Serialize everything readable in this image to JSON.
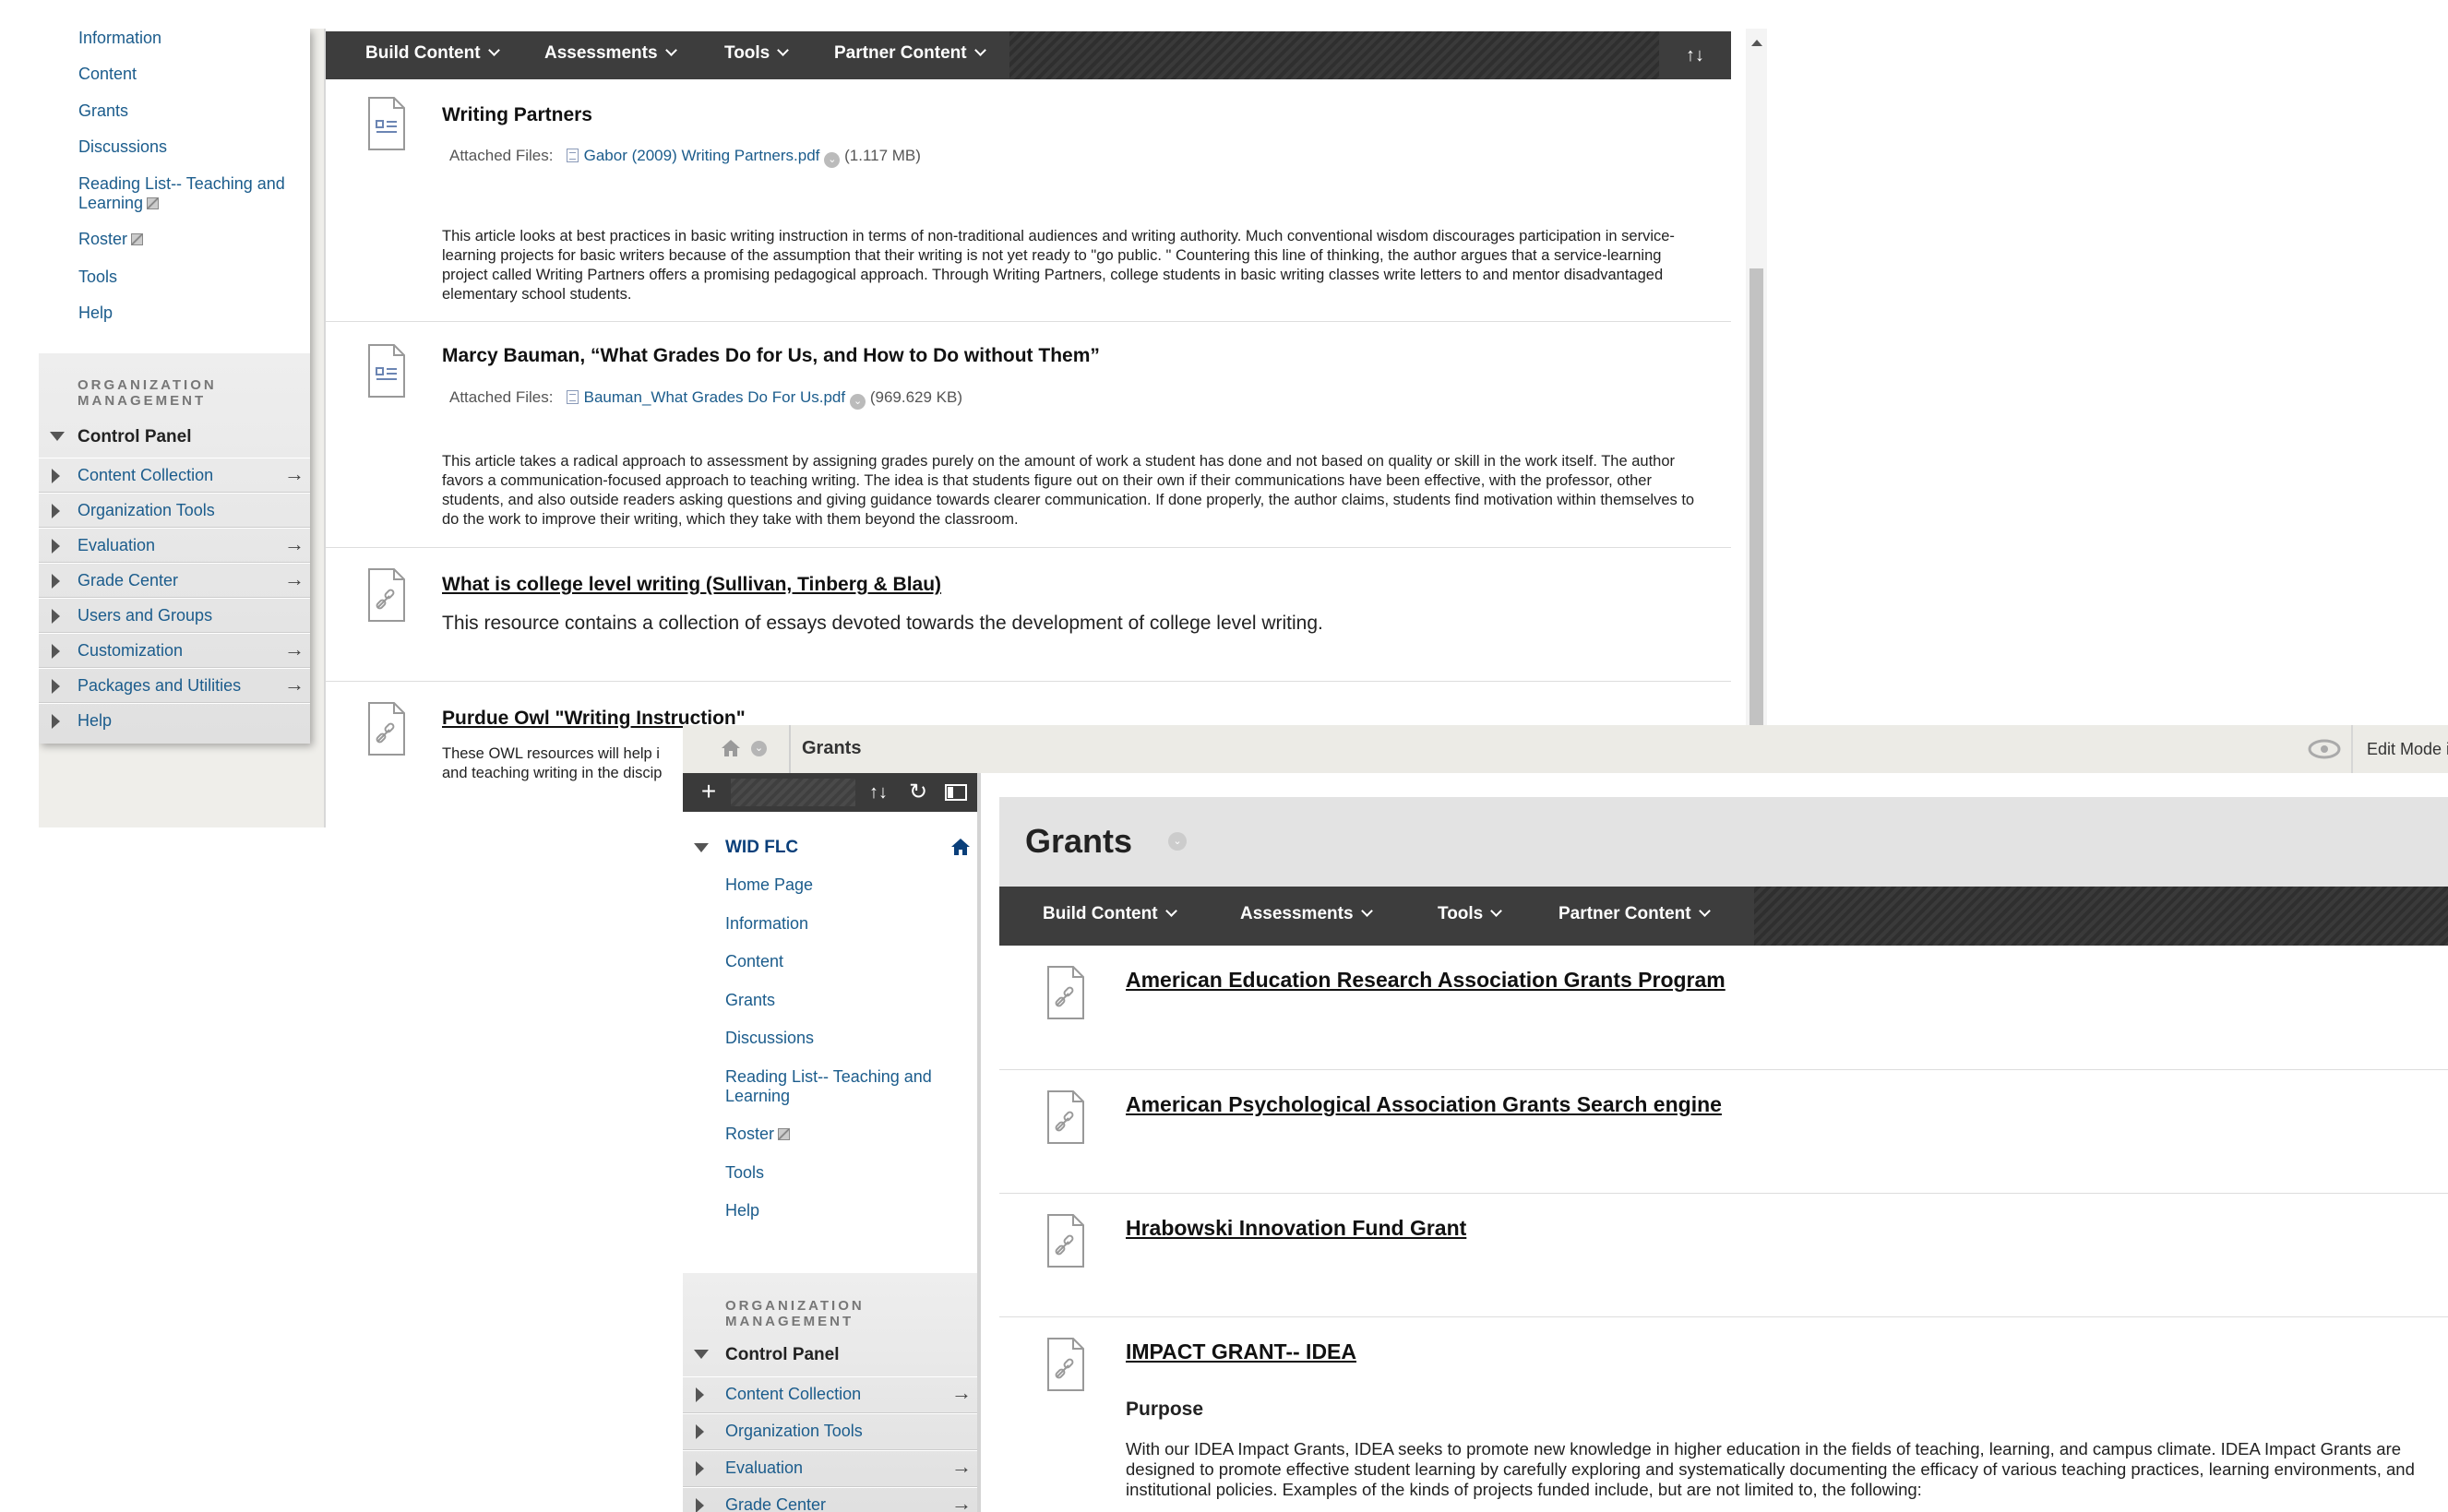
{
  "back": {
    "nav_items": [
      {
        "label": "Information"
      },
      {
        "label": "Content"
      },
      {
        "label": "Grants"
      },
      {
        "label": "Discussions"
      },
      {
        "label": "Reading List-- Teaching and",
        "label2": "Learning"
      },
      {
        "label": "Roster"
      },
      {
        "label": "Tools"
      },
      {
        "label": "Help"
      }
    ],
    "org_title_1": "ORGANIZATION",
    "org_title_2": "MANAGEMENT",
    "control_panel": "Control Panel",
    "cp_items": [
      {
        "label": "Content Collection",
        "arrow": "→"
      },
      {
        "label": "Organization Tools",
        "arrow": ""
      },
      {
        "label": "Evaluation",
        "arrow": "→"
      },
      {
        "label": "Grade Center",
        "arrow": "→"
      },
      {
        "label": "Users and Groups",
        "arrow": ""
      },
      {
        "label": "Customization",
        "arrow": "→"
      },
      {
        "label": "Packages and Utilities",
        "arrow": "→"
      },
      {
        "label": "Help",
        "arrow": ""
      }
    ],
    "toolbar": {
      "build": "Build Content",
      "assess": "Assessments",
      "tools": "Tools",
      "partner": "Partner Content",
      "sort_icon": "↑↓"
    },
    "items": [
      {
        "title": "Writing Partners",
        "attach_label": "Attached Files:",
        "file": "Gabor (2009) Writing Partners.pdf",
        "size": "(1.117 MB)",
        "desc": "This article looks at best practices in basic writing instruction in terms of non-traditional audiences and writing authority. Much conventional wisdom discourages participation in service-learning projects for basic writers because of the assumption that their writing is not yet ready to \"go public. \" Countering this line of thinking, the author argues that a service-learning project called Writing Partners offers a promising pedagogical approach. Through Writing Partners, college students in basic writing classes write letters to and mentor disadvantaged elementary school students."
      },
      {
        "title": "Marcy Bauman, “What Grades Do for Us, and How to Do without Them”",
        "attach_label": "Attached Files:",
        "file": "Bauman_What Grades Do For Us.pdf",
        "size": "(969.629 KB)",
        "desc": "This article takes a radical approach to assessment by assigning grades purely on the amount of work a student has done and not based on quality or skill in the work itself. The author favors a communication-focused approach to teaching writing. The idea is that students figure out on their own if their communications have been effective, with the professor, other students, and also outside readers asking questions and giving guidance towards clearer communication. If done properly, the author claims, students find motivation within themselves to do the work to improve their writing, which they take with them beyond the classroom."
      },
      {
        "title": "What is college level writing (Sullivan, Tinberg & Blau)",
        "desc": "This resource contains a collection of essays devoted towards the development of college level writing."
      },
      {
        "title": "Purdue Owl \"Writing Instruction\"",
        "desc1": "These OWL resources will help i",
        "desc2": "and teaching writing in the discip"
      }
    ]
  },
  "front": {
    "breadcrumb": "Grants",
    "edit_mode": "Edit Mode i",
    "course_title": "WID FLC",
    "nav_items": [
      {
        "label": "Home Page"
      },
      {
        "label": "Information"
      },
      {
        "label": "Content"
      },
      {
        "label": "Grants"
      },
      {
        "label": "Discussions"
      },
      {
        "label": "Reading List-- Teaching and",
        "label2": "Learning"
      },
      {
        "label": "Roster"
      },
      {
        "label": "Tools"
      },
      {
        "label": "Help"
      }
    ],
    "org_title_1": "ORGANIZATION",
    "org_title_2": "MANAGEMENT",
    "control_panel": "Control Panel",
    "cp_items": [
      {
        "label": "Content Collection",
        "arrow": "→"
      },
      {
        "label": "Organization Tools",
        "arrow": ""
      },
      {
        "label": "Evaluation",
        "arrow": "→"
      },
      {
        "label": "Grade Center",
        "arrow": "→"
      }
    ],
    "page_title": "Grants",
    "toolbar": {
      "build": "Build Content",
      "assess": "Assessments",
      "tools": "Tools",
      "partner": "Partner Content"
    },
    "items": [
      {
        "title": "American Education Research Association Grants Program"
      },
      {
        "title": "American Psychological Association Grants Search engine"
      },
      {
        "title": "Hrabowski Innovation Fund Grant"
      },
      {
        "title": "IMPACT GRANT-- IDEA",
        "sub": "Purpose",
        "desc": "With our IDEA Impact Grants, IDEA seeks to promote new knowledge in higher education in the fields of teaching, learning, and campus climate. IDEA Impact Grants are designed to promote effective student learning by carefully exploring and systematically documenting the efficacy of various teaching practices, learning environments, and institutional policies. Examples of the kinds of projects funded include, but are not limited to, the following:"
      }
    ]
  }
}
